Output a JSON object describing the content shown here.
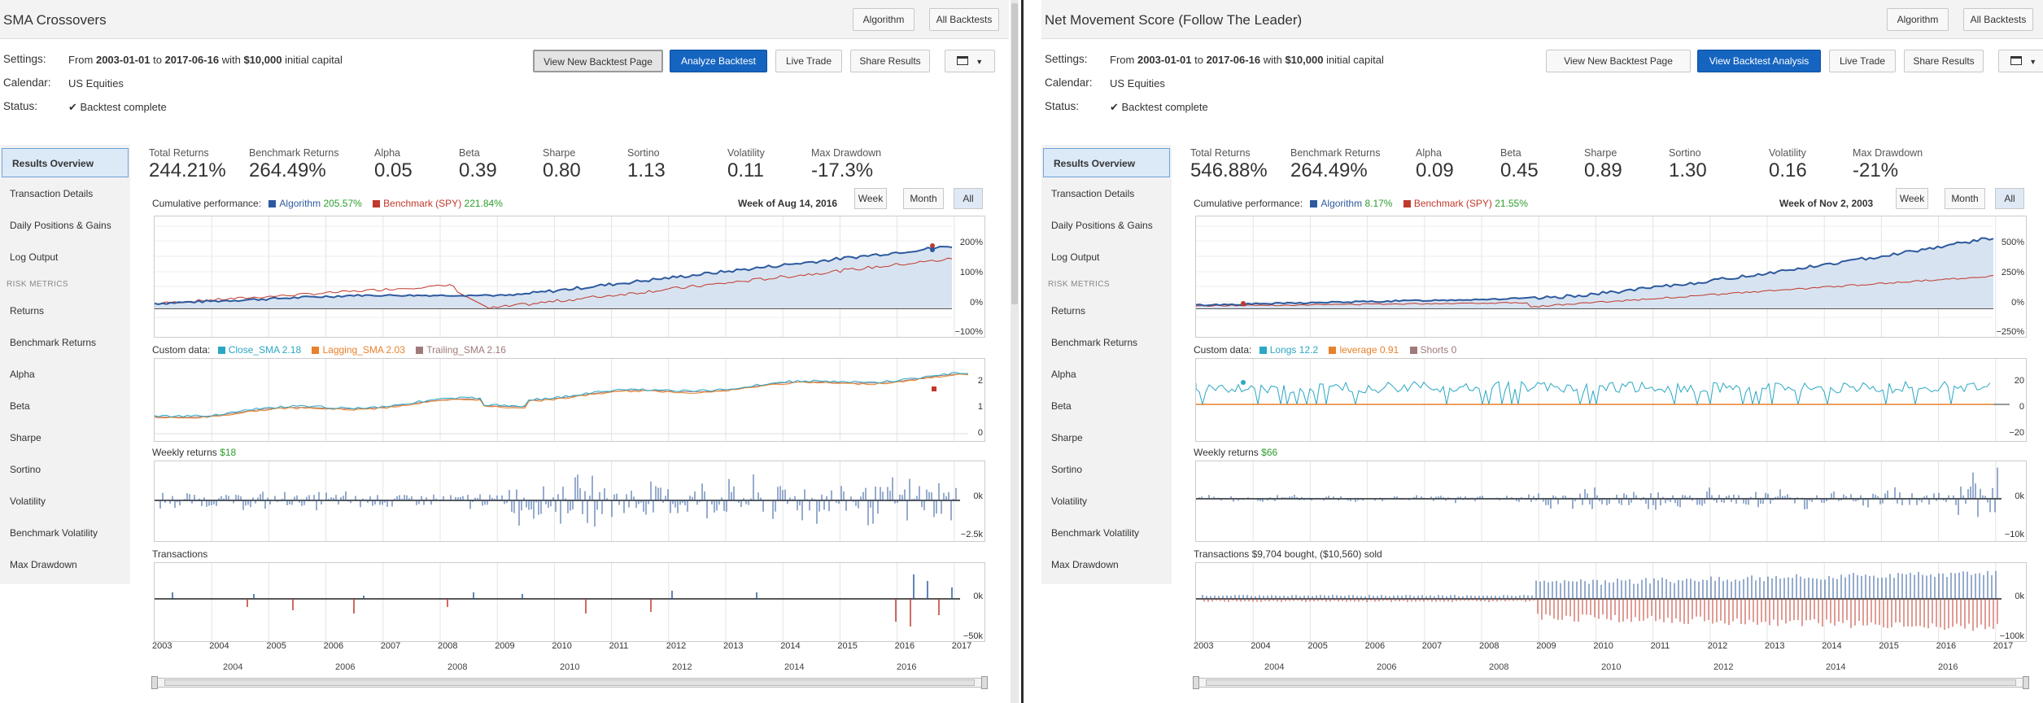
{
  "left": {
    "title": "SMA Crossovers",
    "header_buttons": [
      "Algorithm",
      "All Backtests"
    ],
    "settings_label": "Settings:",
    "settings_from": "From",
    "settings_start": "2003-01-01",
    "settings_to": "to",
    "settings_end": "2017-06-16",
    "settings_with": "with",
    "settings_capital": "$10,000",
    "settings_initial": "initial capital",
    "calendar_label": "Calendar:",
    "calendar_value": "US Equities",
    "status_label": "Status:",
    "status_value": "✔ Backtest complete",
    "actions": [
      "View New Backtest Page",
      "Analyze Backtest",
      "Live Trade",
      "Share Results"
    ],
    "sidebar": [
      "Results Overview",
      "Transaction Details",
      "Daily Positions & Gains",
      "Log Output"
    ],
    "risk_head": "RISK METRICS",
    "risk_items": [
      "Returns",
      "Benchmark Returns",
      "Alpha",
      "Beta",
      "Sharpe",
      "Sortino",
      "Volatility",
      "Benchmark Volatility",
      "Max Drawdown"
    ],
    "metrics": [
      {
        "label": "Total Returns",
        "value": "244.21%"
      },
      {
        "label": "Benchmark Returns",
        "value": "264.49%"
      },
      {
        "label": "Alpha",
        "value": "0.05"
      },
      {
        "label": "Beta",
        "value": "0.39"
      },
      {
        "label": "Sharpe",
        "value": "0.80"
      },
      {
        "label": "Sortino",
        "value": "1.13"
      },
      {
        "label": "Volatility",
        "value": "0.11"
      },
      {
        "label": "Max Drawdown",
        "value": "-17.3%"
      }
    ],
    "cum_label": "Cumulative performance:",
    "cum_algo_name": "Algorithm",
    "cum_algo_val": "205.57%",
    "cum_bench_name": "Benchmark (SPY)",
    "cum_bench_val": "221.84%",
    "week_label": "Week of Aug 14, 2016",
    "ranges": [
      "Week",
      "Month",
      "All"
    ],
    "cum_yticks": [
      "200%",
      "100%",
      "0%",
      "−100%"
    ],
    "custom_label": "Custom data:",
    "custom_series": [
      {
        "name": "Close_SMA",
        "val": "2.18",
        "color": "#2aa7c4"
      },
      {
        "name": "Lagging_SMA",
        "val": "2.03",
        "color": "#e8812b"
      },
      {
        "name": "Trailing_SMA",
        "val": "2.16",
        "color": "#a07a7a"
      }
    ],
    "custom_yticks": [
      "2",
      "1",
      "0"
    ],
    "weekly_label": "Weekly returns",
    "weekly_val": "$18",
    "weekly_yticks": [
      "0k",
      "−2.5k"
    ],
    "trans_label": "Transactions",
    "trans_val": "",
    "trans_yticks": [
      "0k",
      "−50k"
    ],
    "years": [
      "2003",
      "2004",
      "2005",
      "2006",
      "2007",
      "2008",
      "2009",
      "2010",
      "2011",
      "2012",
      "2013",
      "2014",
      "2015",
      "2016",
      "2017"
    ],
    "nav_years": [
      "2004",
      "2006",
      "2008",
      "2010",
      "2012",
      "2014",
      "2016"
    ]
  },
  "right": {
    "title": "Net Movement Score (Follow The Leader)",
    "header_buttons": [
      "Algorithm",
      "All Backtests"
    ],
    "settings_label": "Settings:",
    "settings_from": "From",
    "settings_start": "2003-01-01",
    "settings_to": "to",
    "settings_end": "2017-06-16",
    "settings_with": "with",
    "settings_capital": "$10,000",
    "settings_initial": "initial capital",
    "calendar_label": "Calendar:",
    "calendar_value": "US Equities",
    "status_label": "Status:",
    "status_value": "✔ Backtest complete",
    "actions": [
      "View New Backtest Page",
      "View Backtest Analysis",
      "Live Trade",
      "Share Results"
    ],
    "sidebar": [
      "Results Overview",
      "Transaction Details",
      "Daily Positions & Gains",
      "Log Output"
    ],
    "risk_head": "RISK METRICS",
    "risk_items": [
      "Returns",
      "Benchmark Returns",
      "Alpha",
      "Beta",
      "Sharpe",
      "Sortino",
      "Volatility",
      "Benchmark Volatility",
      "Max Drawdown"
    ],
    "metrics": [
      {
        "label": "Total Returns",
        "value": "546.88%"
      },
      {
        "label": "Benchmark Returns",
        "value": "264.49%"
      },
      {
        "label": "Alpha",
        "value": "0.09"
      },
      {
        "label": "Beta",
        "value": "0.45"
      },
      {
        "label": "Sharpe",
        "value": "0.89"
      },
      {
        "label": "Sortino",
        "value": "1.30"
      },
      {
        "label": "Volatility",
        "value": "0.16"
      },
      {
        "label": "Max Drawdown",
        "value": "-21%"
      }
    ],
    "cum_label": "Cumulative performance:",
    "cum_algo_name": "Algorithm",
    "cum_algo_val": "8.17%",
    "cum_bench_name": "Benchmark (SPY)",
    "cum_bench_val": "21.55%",
    "week_label": "Week of Nov 2, 2003",
    "ranges": [
      "Week",
      "Month",
      "All"
    ],
    "cum_yticks": [
      "500%",
      "250%",
      "0%",
      "−250%"
    ],
    "custom_label": "Custom data:",
    "custom_series": [
      {
        "name": "Longs",
        "val": "12.2",
        "color": "#2aa7c4"
      },
      {
        "name": "leverage",
        "val": "0.91",
        "color": "#e8812b"
      },
      {
        "name": "Shorts",
        "val": "0",
        "color": "#a07a7a"
      }
    ],
    "custom_yticks": [
      "20",
      "0",
      "−20"
    ],
    "weekly_label": "Weekly returns",
    "weekly_val": "$66",
    "weekly_yticks": [
      "0k",
      "−10k"
    ],
    "trans_label": "Transactions",
    "trans_val": "$9,704 bought, ($10,560) sold",
    "trans_yticks": [
      "0k",
      "−100k"
    ],
    "years": [
      "2003",
      "2004",
      "2005",
      "2006",
      "2007",
      "2008",
      "2009",
      "2010",
      "2011",
      "2012",
      "2013",
      "2014",
      "2015",
      "2016",
      "2017"
    ],
    "nav_years": [
      "2004",
      "2006",
      "2008",
      "2010",
      "2012",
      "2014",
      "2016"
    ]
  },
  "colors": {
    "algorithm": "#2d5a9e",
    "benchmark": "#c0392b",
    "primary": "#1565c0",
    "positive": "#2e9e2e"
  }
}
